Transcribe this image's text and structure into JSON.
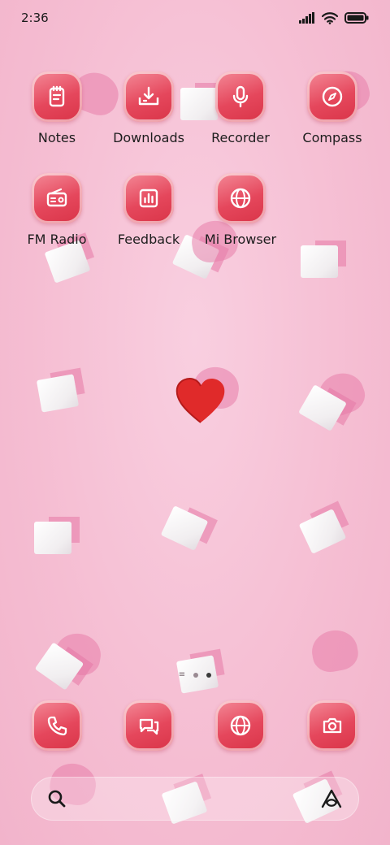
{
  "status": {
    "time": "2:36"
  },
  "apps": [
    {
      "label": "Notes",
      "icon": "notes-icon"
    },
    {
      "label": "Downloads",
      "icon": "download-icon"
    },
    {
      "label": "Recorder",
      "icon": "microphone-icon"
    },
    {
      "label": "Compass",
      "icon": "compass-icon"
    },
    {
      "label": "FM Radio",
      "icon": "radio-icon"
    },
    {
      "label": "Feedback",
      "icon": "bar-chart-icon"
    },
    {
      "label": "Mi Browser",
      "icon": "globe-icon"
    }
  ],
  "dock": [
    {
      "icon": "phone-icon"
    },
    {
      "icon": "messages-icon"
    },
    {
      "icon": "globe-icon"
    },
    {
      "icon": "camera-icon"
    }
  ],
  "pager": {
    "pages": 2,
    "current": 2
  },
  "colors": {
    "icon_red": "#e5475c",
    "wallpaper_pink": "#f7c3d6",
    "text": "#1d1d1d"
  }
}
